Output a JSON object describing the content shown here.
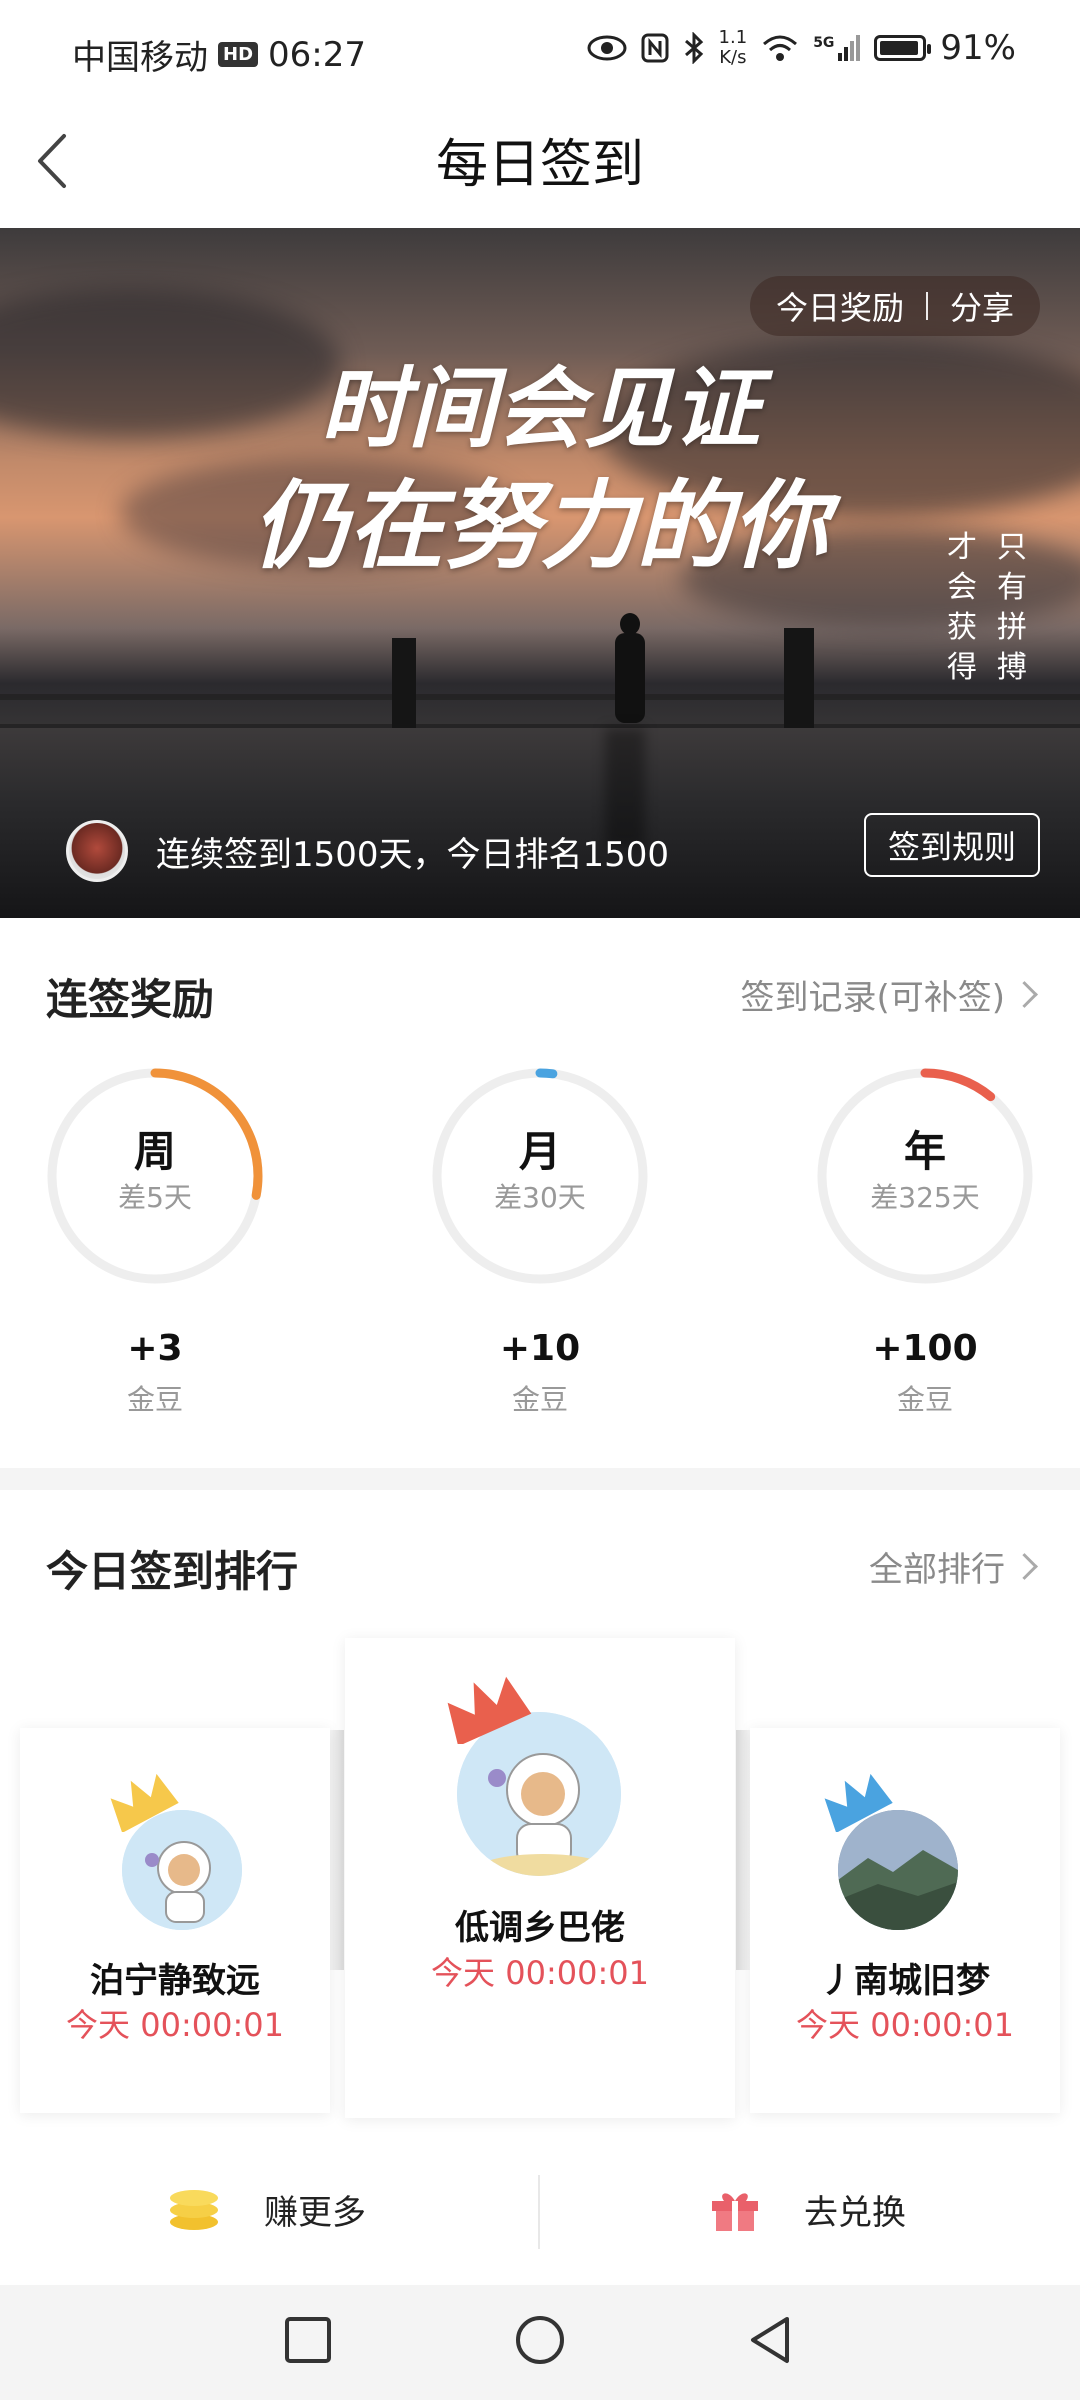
{
  "status_bar": {
    "carrier": "中国移动",
    "hd": "HD",
    "time": "06:27",
    "net_speed_value": "1.1",
    "net_speed_unit": "K/s",
    "signal": "5G",
    "battery": "91%"
  },
  "nav": {
    "title": "每日签到"
  },
  "hero": {
    "reward_label": "今日奖励",
    "share_label": "分享",
    "calligraphy_line1": "时间会见证",
    "calligraphy_line2": "仍在努力的你",
    "vertical_col1": "只有拼搏",
    "vertical_col2": "才会获得",
    "streak_text": "连续签到1500天，今日排名1500",
    "rule_button": "签到规则"
  },
  "streak": {
    "title": "连签奖励",
    "link": "签到记录(可补签)",
    "items": [
      {
        "period": "周",
        "remain": "差5天",
        "reward": "+3",
        "unit": "金豆",
        "progress": 0.28,
        "color": "#f0923a"
      },
      {
        "period": "月",
        "remain": "差30天",
        "reward": "+10",
        "unit": "金豆",
        "progress": 0.02,
        "color": "#4aa3e0"
      },
      {
        "period": "年",
        "remain": "差325天",
        "reward": "+100",
        "unit": "金豆",
        "progress": 0.11,
        "color": "#e9604d"
      }
    ]
  },
  "ranking": {
    "title": "今日签到排行",
    "link": "全部排行",
    "entries": [
      {
        "name": "泊宁静致远",
        "time": "今天 00:00:01",
        "crown_color": "#f6c84b"
      },
      {
        "name": "低调乡巴佬",
        "time": "今天 00:00:01",
        "crown_color": "#e9604d"
      },
      {
        "name": "丿南城旧梦",
        "time": "今天 00:00:01",
        "crown_color": "#4aa3e0"
      }
    ]
  },
  "actions": {
    "earn": "赚更多",
    "exchange": "去兑换"
  },
  "colors": {
    "accent_red": "#e4525a",
    "gold": "#f6c84b"
  }
}
